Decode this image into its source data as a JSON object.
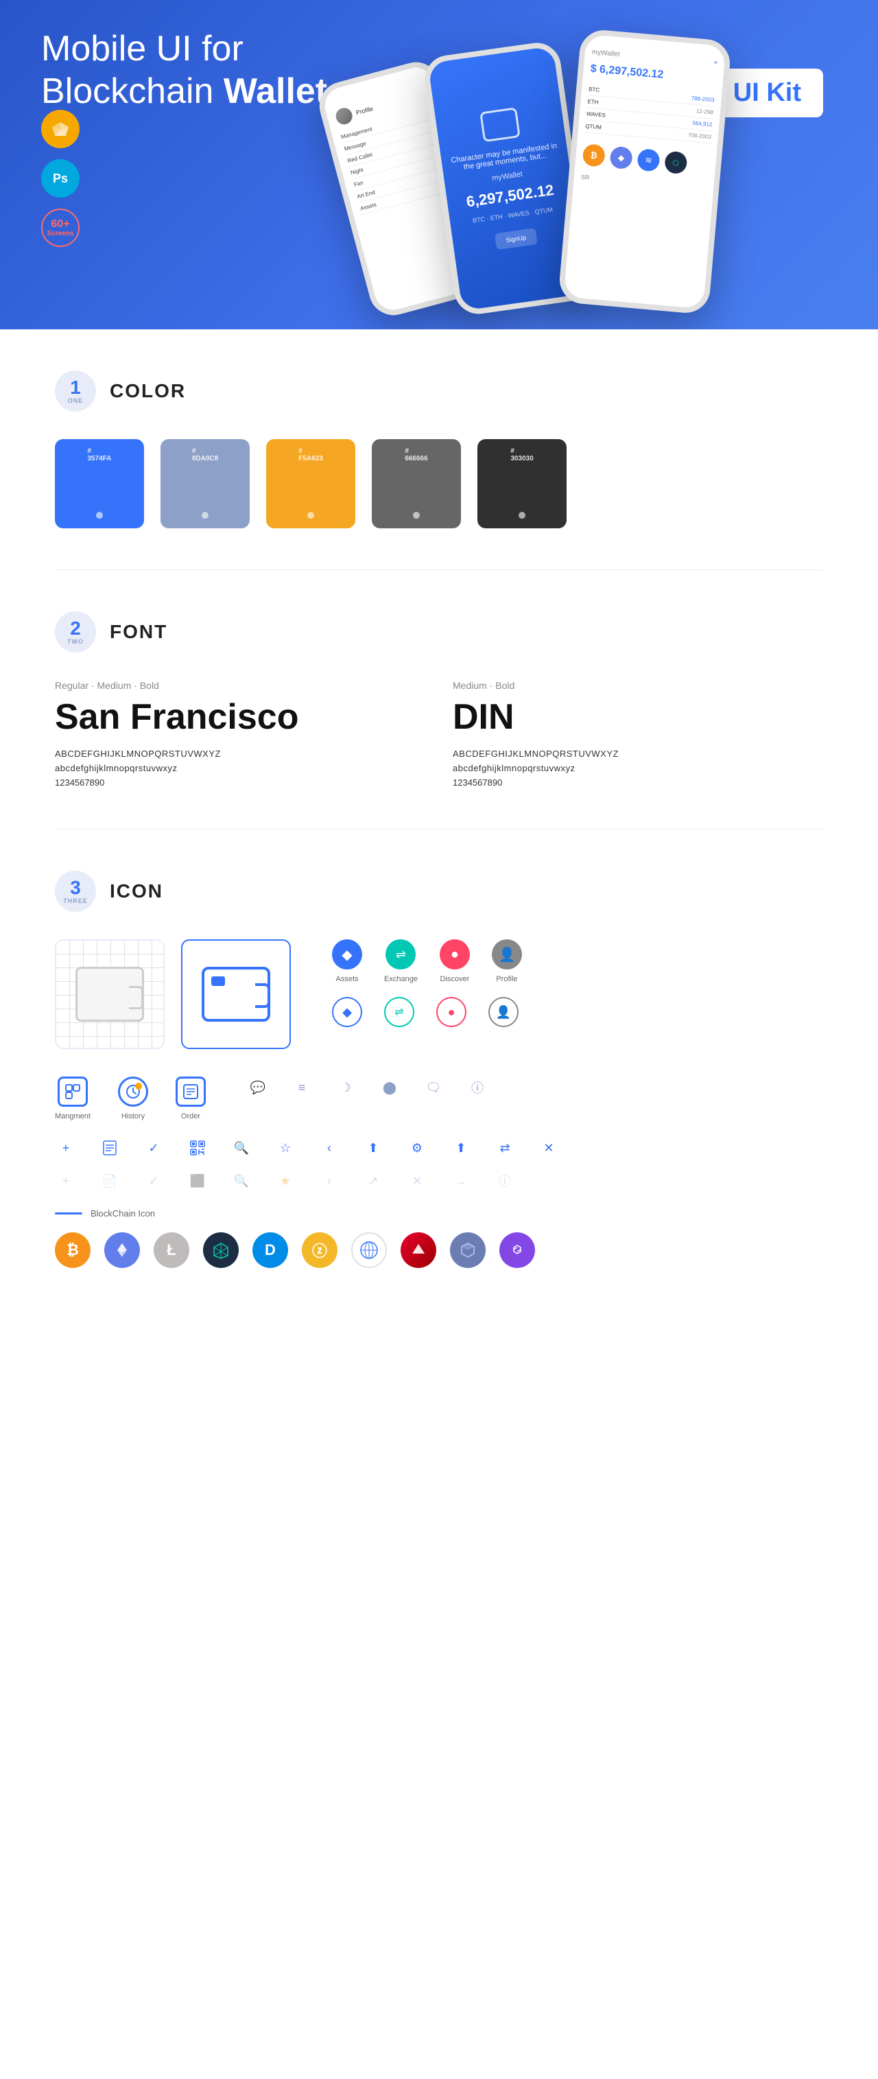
{
  "hero": {
    "title_regular": "Mobile UI for Blockchain ",
    "title_bold": "Wallet",
    "badge": "UI Kit",
    "sketch_label": "Sketch",
    "ps_label": "Ps",
    "screens_count": "60+",
    "screens_label": "Screens"
  },
  "sections": {
    "color": {
      "number": "1",
      "word": "ONE",
      "title": "COLOR",
      "swatches": [
        {
          "hex": "#3574FA",
          "label": "#\n3574FA"
        },
        {
          "hex": "#8DA0C8",
          "label": "#\n8DA0C8"
        },
        {
          "hex": "#F5A623",
          "label": "#\nF5A623"
        },
        {
          "hex": "#666666",
          "label": "#\n666666"
        },
        {
          "hex": "#303030",
          "label": "#\n303030"
        }
      ]
    },
    "font": {
      "number": "2",
      "word": "TWO",
      "title": "FONT",
      "font1": {
        "style": "Regular · Medium · Bold",
        "name": "San Francisco",
        "upper": "ABCDEFGHIJKLMNOPQRSTUVWXYZ",
        "lower": "abcdefghijklmnopqrstuvwxyz",
        "numbers": "1234567890"
      },
      "font2": {
        "style": "Medium · Bold",
        "name": "DIN",
        "upper": "ABCDEFGHIJKLMNOPQRSTUVWXYZ",
        "lower": "abcdefghijklmnopqrstuvwxyz",
        "numbers": "1234567890"
      }
    },
    "icon": {
      "number": "3",
      "word": "THREE",
      "title": "ICON",
      "nav_icons": [
        {
          "label": "Mangment"
        },
        {
          "label": "History"
        },
        {
          "label": "Order"
        }
      ],
      "colored_icons": [
        {
          "label": "Assets"
        },
        {
          "label": "Exchange"
        },
        {
          "label": "Discover"
        },
        {
          "label": "Profile"
        }
      ],
      "blockchain_label": "BlockChain Icon",
      "crypto_coins": [
        "BTC",
        "ETH",
        "LTC",
        "BURST",
        "DASH",
        "ZCASH",
        "GRID",
        "ARK",
        "STONE",
        "MATIC"
      ]
    }
  }
}
